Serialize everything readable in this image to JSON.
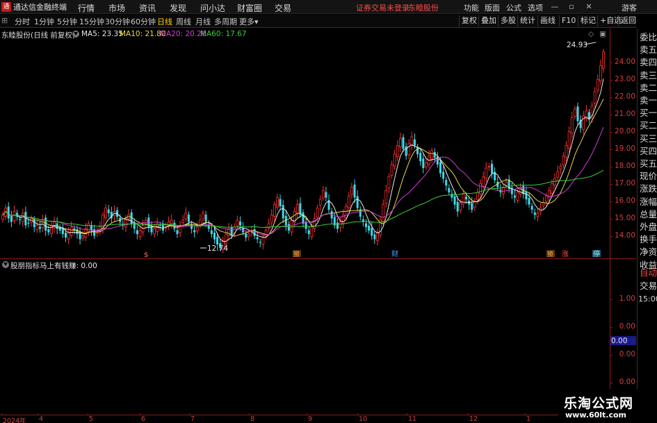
{
  "app": {
    "title": "通达信金融终端"
  },
  "menu": [
    "行情",
    "市场",
    "资讯",
    "发现",
    "问小达",
    "财富圈",
    "交易"
  ],
  "notice": {
    "text": "证券交易未登录",
    "stock": "东睦股份"
  },
  "right_menu": [
    "功能",
    "版面",
    "公式",
    "选项"
  ],
  "right_user": "游客",
  "window_buttons": {
    "minimize": "—",
    "restore": "▫",
    "close": "✕"
  },
  "periods": [
    "分时",
    "1分钟",
    "5分钟",
    "15分钟",
    "30分钟",
    "60分钟",
    "日线",
    "周线",
    "月线",
    "多周期",
    "更多"
  ],
  "active_period": "日线",
  "toolbar": [
    "复权",
    "叠加",
    "多股",
    "统计",
    "画线",
    "F10",
    "标记",
    "+自选",
    "返回"
  ],
  "info": {
    "stock": "东睦股份(日线 前复权)",
    "ma5_label": "MA5: 23.35",
    "ma10_label": "MA10: 21.80",
    "ma20_label": "MA20: 20.26",
    "ma60_label": "MA60: 17.67"
  },
  "colors": {
    "up": "#ff3030",
    "down": "#3fd8e8",
    "ma5": "#e8e8e8",
    "ma10": "#e8d84a",
    "ma20": "#d23cd2",
    "ma60": "#3ad23a",
    "axis": "#d04040"
  },
  "price_ticks": [
    "24.00",
    "23.00",
    "22.00",
    "21.00",
    "20.00",
    "19.00",
    "18.00",
    "17.00",
    "16.00",
    "15.00",
    "14.00"
  ],
  "markers": {
    "high": "24.93",
    "low": "12.74"
  },
  "event_tags": [
    "$",
    "预",
    "财",
    "预",
    "涨",
    "停"
  ],
  "sub": {
    "title": "股朋指标",
    "formula": "马上有钱赚: 0.00"
  },
  "sub_ticks": [
    "1.00",
    "0.00",
    "0.00",
    "0.00",
    "0.00",
    "0.00"
  ],
  "sub_highlight": "0.00",
  "side_panel": [
    "委比",
    "卖五",
    "卖四",
    "卖三",
    "卖二",
    "卖一",
    "买一",
    "买二",
    "买三",
    "买四",
    "买五",
    "现价",
    "涨跌",
    "涨幅",
    "总量",
    "外盘",
    "换手",
    "净资",
    "收益"
  ],
  "side_bottom": [
    "自动",
    "交易",
    "15:00"
  ],
  "side_corner": "\u0000",
  "dates": [
    "2024年",
    "4",
    "5",
    "6",
    "7",
    "8",
    "9",
    "10",
    "11",
    "12",
    "1"
  ],
  "watermark": {
    "line1": "乐淘公式网",
    "line2": "www.60lt.com"
  },
  "chart_data": {
    "type": "candlestick",
    "title": "东睦股份(日线 前复权)",
    "ylim": [
      13.3,
      25.3
    ],
    "x": [
      "2024年",
      "4",
      "5",
      "6",
      "7",
      "8",
      "9",
      "10",
      "11",
      "12",
      "1"
    ],
    "close": [
      15.2,
      15.6,
      15.0,
      14.8,
      15.4,
      15.1,
      14.9,
      15.3,
      14.6,
      14.7,
      15.0,
      14.5,
      14.6,
      14.4,
      14.9,
      14.3,
      14.2,
      14.6,
      14.8,
      14.4,
      14.3,
      14.1,
      13.9,
      14.2,
      14.5,
      14.3,
      14.1,
      13.8,
      14.0,
      14.4,
      14.7,
      14.3,
      14.0,
      14.2,
      14.5,
      15.2,
      15.6,
      15.3,
      15.0,
      15.4,
      15.1,
      14.8,
      14.6,
      14.9,
      15.2,
      14.7,
      14.4,
      14.1,
      14.3,
      14.6,
      14.9,
      14.5,
      14.2,
      14.4,
      14.7,
      14.6,
      14.3,
      14.5,
      14.8,
      14.9,
      14.4,
      14.1,
      14.6,
      14.9,
      15.3,
      14.8,
      14.4,
      14.2,
      14.5,
      14.9,
      15.3,
      14.8,
      14.4,
      14.1,
      13.8,
      13.5,
      13.3,
      13.7,
      14.1,
      14.4,
      14.0,
      14.5,
      14.9,
      14.6,
      14.2,
      13.9,
      14.1,
      14.3,
      14.0,
      13.8,
      13.6,
      13.9,
      14.3,
      14.7,
      15.2,
      15.8,
      16.2,
      15.7,
      15.0,
      14.6,
      14.3,
      14.9,
      15.4,
      15.8,
      15.2,
      14.7,
      14.4,
      14.1,
      14.5,
      15.0,
      15.6,
      16.1,
      16.6,
      16.2,
      15.5,
      15.0,
      14.6,
      14.4,
      14.8,
      15.2,
      15.7,
      16.3,
      16.8,
      16.2,
      15.6,
      15.1,
      14.8,
      14.5,
      14.3,
      14.0,
      13.8,
      14.2,
      14.9,
      15.8,
      16.6,
      17.4,
      18.1,
      18.7,
      19.2,
      19.6,
      19.0,
      18.6,
      19.3,
      19.7,
      19.2,
      18.7,
      18.3,
      17.9,
      18.2,
      18.6,
      18.9,
      18.5,
      18.1,
      17.6,
      17.3,
      16.9,
      16.5,
      16.2,
      15.8,
      15.4,
      15.9,
      16.4,
      16.1,
      15.8,
      15.5,
      16.0,
      16.5,
      17.0,
      17.4,
      17.9,
      18.0,
      17.6,
      17.2,
      16.8,
      16.5,
      16.8,
      17.1,
      16.7,
      16.4,
      16.2,
      16.5,
      16.8,
      16.4,
      16.1,
      15.8,
      15.5,
      15.2,
      15.3,
      15.6,
      15.9,
      16.3,
      16.6,
      17.0,
      17.3,
      17.7,
      18.0,
      18.6,
      19.2,
      20.0,
      20.8,
      21.3,
      20.6,
      20.2,
      20.9,
      21.2,
      20.7,
      21.5,
      22.3,
      23.0,
      23.8,
      24.6
    ]
  }
}
